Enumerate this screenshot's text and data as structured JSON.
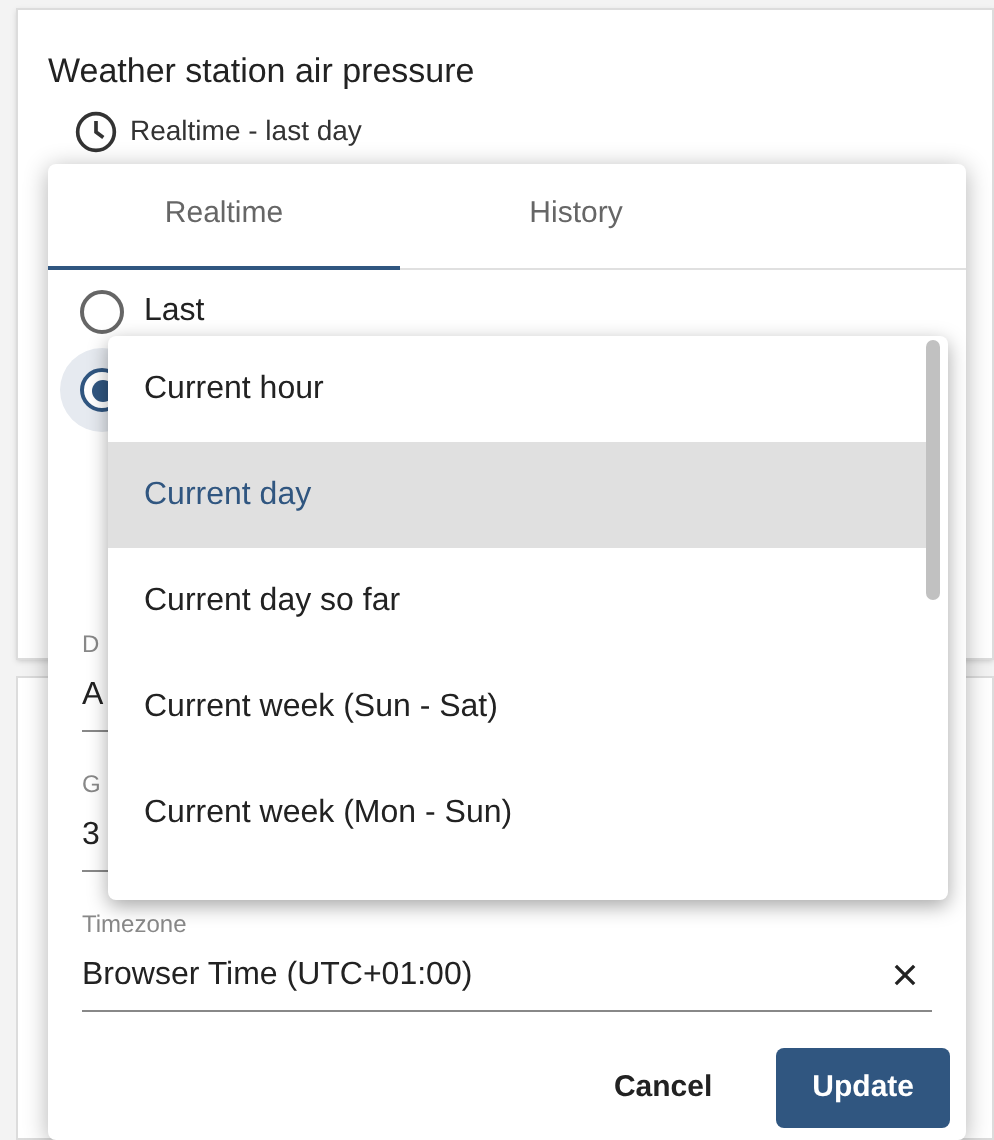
{
  "card": {
    "title": "Weather station air pressure",
    "timewindow": "Realtime - last day"
  },
  "dialog": {
    "tabs": [
      {
        "label": "Realtime",
        "selected": true
      },
      {
        "label": "History",
        "selected": false
      }
    ],
    "radios": [
      {
        "label": "Last",
        "selected": false
      },
      {
        "selected": true
      }
    ],
    "fields": [
      {
        "label": "D",
        "value": "A"
      },
      {
        "label": "G",
        "value": "3"
      },
      {
        "label": "Timezone",
        "value": "Browser Time (UTC+01:00)",
        "clearable": true
      }
    ],
    "buttons": [
      {
        "label": "Cancel",
        "kind": "text"
      },
      {
        "label": "Update",
        "kind": "primary"
      }
    ]
  },
  "dropdown": {
    "options": [
      {
        "label": "Current hour",
        "selected": false
      },
      {
        "label": "Current day",
        "selected": true
      },
      {
        "label": "Current day so far",
        "selected": false
      },
      {
        "label": "Current week (Sun - Sat)",
        "selected": false
      },
      {
        "label": "Current week (Mon - Sun)",
        "selected": false
      }
    ]
  }
}
